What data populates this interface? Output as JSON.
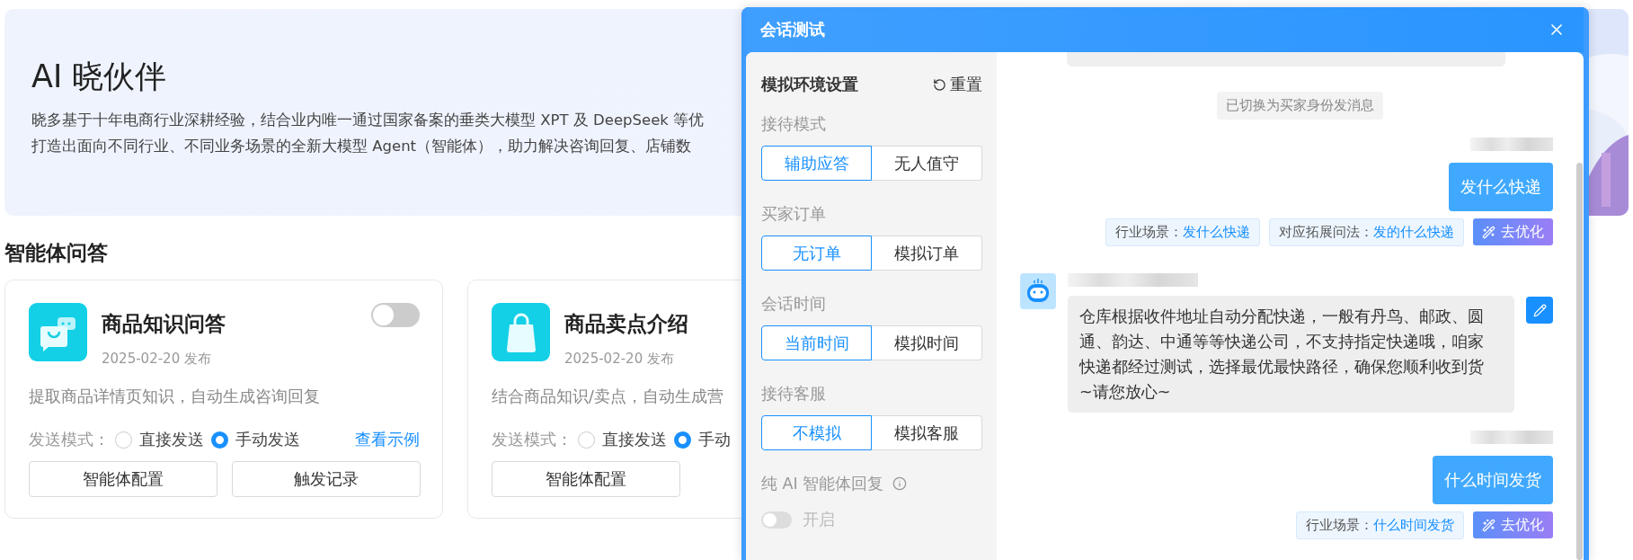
{
  "hero": {
    "title": "AI 晓伙伴",
    "description_lines": [
      "晓多基于十年电商行业深耕经验，结合业内唯一通过国家备案的垂类大模型 XPT 及 DeepSeek 等优",
      "打造出面向不同行业、不同业务场景的全新大模型 Agent（智能体），助力解决咨询回复、店铺数"
    ]
  },
  "section_title": "智能体问答",
  "agents": [
    {
      "kind": "chat-bag",
      "title": "商品知识问答",
      "date": "2025-02-20 发布",
      "enabled": false,
      "description": "提取商品详情页知识，自动生成咨询回复",
      "send_mode_label": "发送模式：",
      "send_modes": [
        {
          "label": "直接发送",
          "selected": false
        },
        {
          "label": "手动发送",
          "selected": true
        }
      ],
      "example_link": "查看示例",
      "buttons": [
        "智能体配置",
        "触发记录"
      ]
    },
    {
      "kind": "bag",
      "title": "商品卖点介绍",
      "date": "2025-02-20 发布",
      "description": "结合商品知识/卖点，自动生成营",
      "send_mode_label": "发送模式：",
      "send_modes": [
        {
          "label": "直接发送",
          "selected": false
        },
        {
          "label": "手动",
          "selected": true
        }
      ],
      "buttons": [
        "智能体配置"
      ]
    }
  ],
  "modal": {
    "title": "会话测试",
    "settings": {
      "title": "模拟环境设置",
      "reset": "重置",
      "groups": [
        {
          "label": "接待模式",
          "options": [
            {
              "label": "辅助应答",
              "selected": true
            },
            {
              "label": "无人值守",
              "selected": false
            }
          ]
        },
        {
          "label": "买家订单",
          "options": [
            {
              "label": "无订单",
              "selected": true
            },
            {
              "label": "模拟订单",
              "selected": false
            }
          ]
        },
        {
          "label": "会话时间",
          "options": [
            {
              "label": "当前时间",
              "selected": true
            },
            {
              "label": "模拟时间",
              "selected": false
            }
          ]
        },
        {
          "label": "接待客服",
          "options": [
            {
              "label": "不模拟",
              "selected": true
            },
            {
              "label": "模拟客服",
              "selected": false
            }
          ]
        }
      ],
      "pure_ai": {
        "label": "纯 AI 智能体回复",
        "toggle_label": "开启",
        "on": false
      }
    },
    "messages": [
      {
        "kind": "cut"
      },
      {
        "kind": "system",
        "text": "已切换为买家身份发消息"
      },
      {
        "kind": "buyer",
        "text": "发什么快递",
        "tags": [
          {
            "label": "行业场景：",
            "value": "发什么快递"
          },
          {
            "label": "对应拓展问法：",
            "value": "发的什么快递"
          }
        ],
        "action": "去优化"
      },
      {
        "kind": "bot",
        "text": "仓库根据收件地址自动分配快递，一般有丹鸟、邮政、圆通、韵达、中通等等快递公司，不支持指定快递哦，咱家快递都经过测试，选择最优最快路径，确保您顺利收到货~请您放心~"
      },
      {
        "kind": "buyer",
        "text": "什么时间发货",
        "tags": [
          {
            "label": "行业场景：",
            "value": "什么时间发货"
          }
        ],
        "action": "去优化"
      }
    ]
  }
}
